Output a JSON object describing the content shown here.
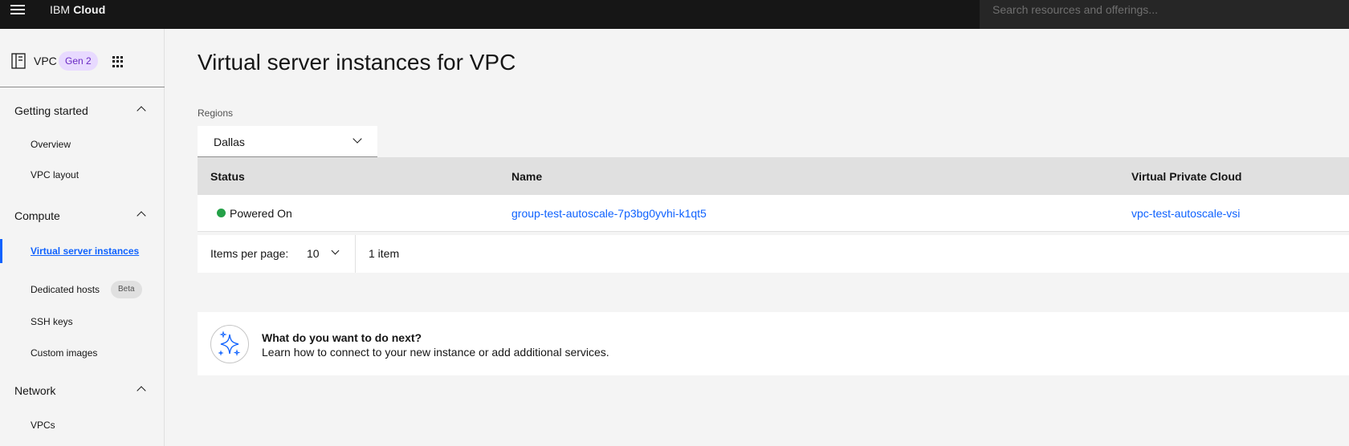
{
  "topbar": {
    "brand_prefix": "IBM",
    "brand_suffix": "Cloud",
    "search_placeholder": "Search resources and offerings..."
  },
  "sidebar": {
    "title": "VPC",
    "gen_badge": "Gen 2",
    "sections": [
      {
        "label": "Getting started",
        "items": [
          {
            "label": "Overview"
          },
          {
            "label": "VPC layout"
          }
        ]
      },
      {
        "label": "Compute",
        "items": [
          {
            "label": "Virtual server instances",
            "active": true
          },
          {
            "label": "Dedicated hosts",
            "badge": "Beta"
          },
          {
            "label": "SSH keys"
          },
          {
            "label": "Custom images"
          }
        ]
      },
      {
        "label": "Network",
        "items": [
          {
            "label": "VPCs"
          }
        ]
      }
    ]
  },
  "main": {
    "title": "Virtual server instances for VPC",
    "regions_label": "Regions",
    "region_value": "Dallas",
    "table": {
      "columns": [
        "Status",
        "Name",
        "Virtual Private Cloud"
      ],
      "rows": [
        {
          "status": "Powered On",
          "name": "group-test-autoscale-7p3bg0yvhi-k1qt5",
          "vpc": "vpc-test-autoscale-vsi"
        }
      ]
    },
    "pagination": {
      "items_per_page_label": "Items per page:",
      "items_per_page_value": "10",
      "count_text": "1 item"
    },
    "next_steps": {
      "title": "What do you want to do next?",
      "description": "Learn how to connect to your new instance or add additional services."
    }
  },
  "colors": {
    "accent": "#0f62fe",
    "status_on": "#24a148",
    "gen_badge_bg": "#e8daff",
    "gen_badge_text": "#6929c4",
    "topbar_bg": "#161616"
  },
  "icons": [
    "menu-icon",
    "vpc-doc-icon",
    "app-switcher-icon",
    "chevron-up-icon",
    "chevron-down-icon",
    "sparkle-icon"
  ]
}
